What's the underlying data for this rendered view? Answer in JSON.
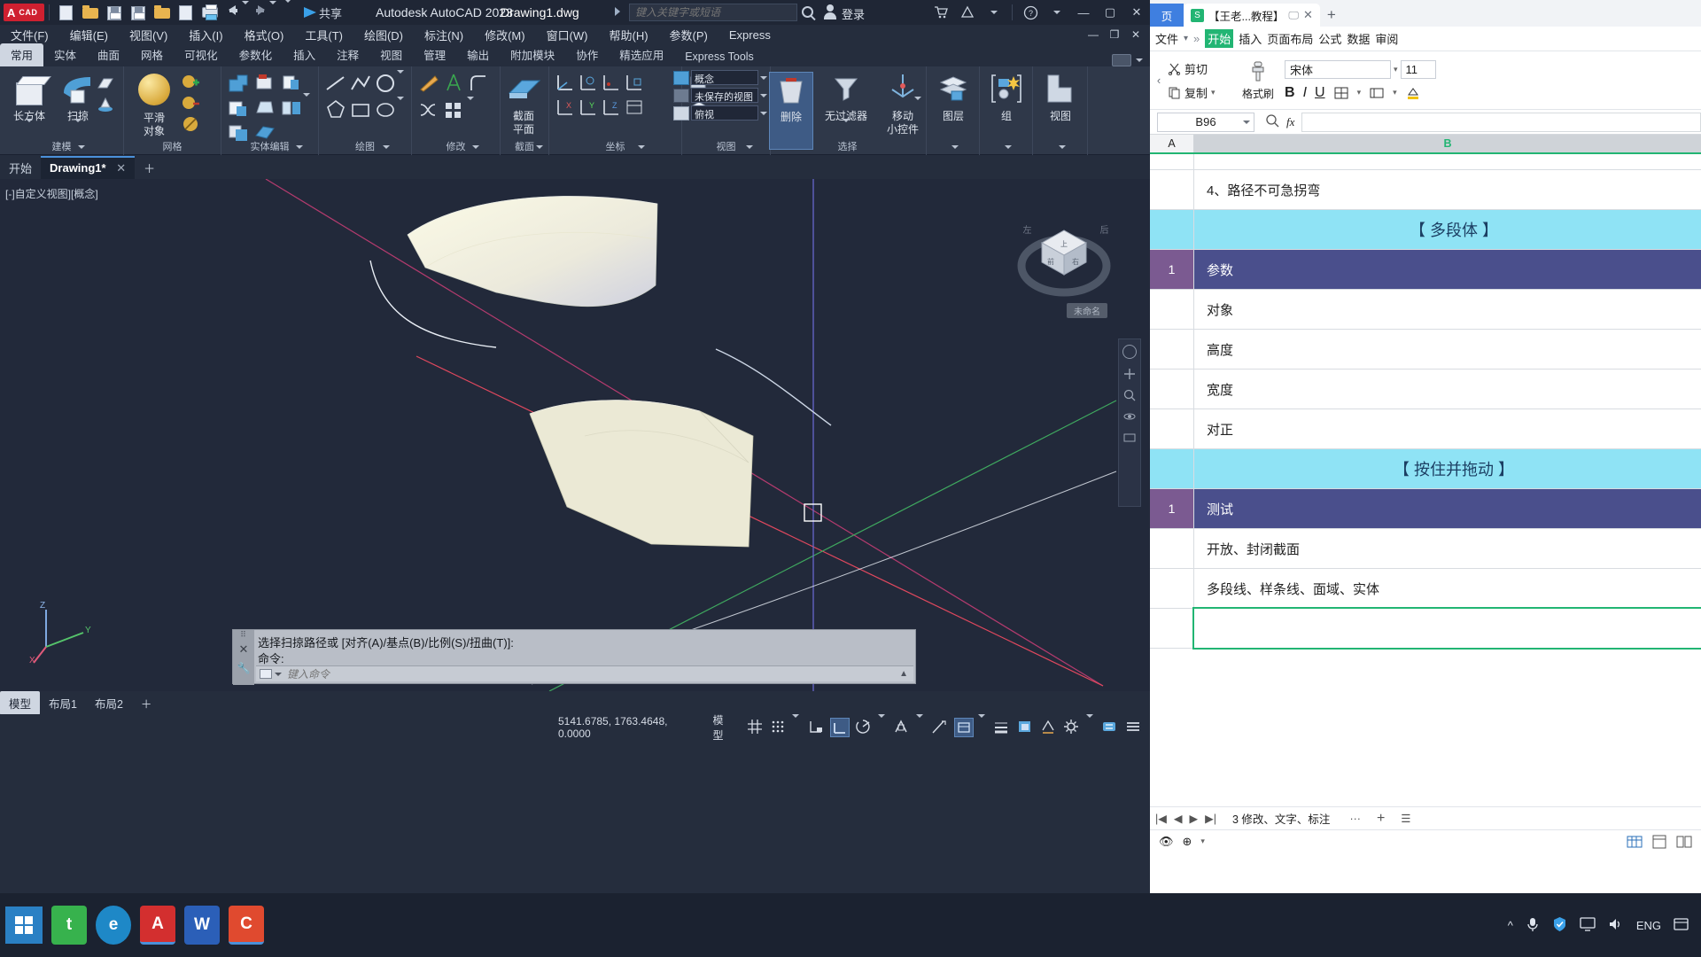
{
  "acad": {
    "quick_access": {
      "logo_a": "A",
      "logo_cad": "CAD",
      "icons": [
        "new-file-icon",
        "open-folder-icon",
        "save-icon",
        "save-as-icon",
        "open-from-web-icon",
        "publish-icon",
        "plot-icon",
        "undo-icon",
        "redo-icon",
        "more-icon"
      ],
      "share_label": "共享"
    },
    "title": "Autodesk AutoCAD 2023",
    "file_name": "Drawing1.dwg",
    "search_placeholder": "键入关键字或短语",
    "login_label": "登录",
    "window_buttons": [
      "minimize",
      "maximize",
      "close"
    ],
    "menubar": [
      "文件(F)",
      "编辑(E)",
      "视图(V)",
      "插入(I)",
      "格式(O)",
      "工具(T)",
      "绘图(D)",
      "标注(N)",
      "修改(M)",
      "窗口(W)",
      "帮助(H)",
      "参数(P)",
      "Express"
    ],
    "ribbon_tabs": [
      {
        "label": "常用",
        "active": true
      },
      {
        "label": "实体",
        "active": false
      },
      {
        "label": "曲面",
        "active": false
      },
      {
        "label": "网格",
        "active": false
      },
      {
        "label": "可视化",
        "active": false
      },
      {
        "label": "参数化",
        "active": false
      },
      {
        "label": "插入",
        "active": false
      },
      {
        "label": "注释",
        "active": false
      },
      {
        "label": "视图",
        "active": false
      },
      {
        "label": "管理",
        "active": false
      },
      {
        "label": "输出",
        "active": false
      },
      {
        "label": "附加模块",
        "active": false
      },
      {
        "label": "协作",
        "active": false
      },
      {
        "label": "精选应用",
        "active": false
      },
      {
        "label": "Express Tools",
        "active": false
      }
    ],
    "panels": [
      {
        "name": "建模",
        "has_dropdown": true,
        "big": [
          {
            "label": "长方体",
            "icon": "box-icon"
          },
          {
            "label": "扫掠",
            "icon": "sweep-icon"
          }
        ]
      },
      {
        "name": "网格",
        "has_dropdown": false,
        "big": [
          {
            "label": "平滑\n对象",
            "icon": "smooth-object-icon"
          }
        ]
      },
      {
        "name": "实体编辑",
        "has_dropdown": true,
        "big": []
      },
      {
        "name": "绘图",
        "has_dropdown": true,
        "big": []
      },
      {
        "name": "修改",
        "has_dropdown": true,
        "big": []
      },
      {
        "name": "截面",
        "has_dropdown": true,
        "big": [
          {
            "label": "截面\n平面",
            "icon": "section-plane-icon"
          }
        ]
      },
      {
        "name": "坐标",
        "has_dropdown": true,
        "big": []
      },
      {
        "name": "视图",
        "has_dropdown": true,
        "big": []
      },
      {
        "name": "选择",
        "has_dropdown": false,
        "big": [
          {
            "label": "删除",
            "icon": "delete-icon"
          },
          {
            "label": "无过滤器",
            "icon": "filter-icon"
          },
          {
            "label": "移动\n小控件",
            "icon": "move-gizmo-icon"
          }
        ]
      },
      {
        "name": "图层",
        "has_dropdown": true,
        "big": [
          {
            "label": "图层",
            "icon": "layers-icon"
          }
        ]
      },
      {
        "name": "组",
        "has_dropdown": true,
        "big": [
          {
            "label": "组",
            "icon": "group-icon"
          }
        ]
      },
      {
        "name": "视图",
        "has_dropdown": true,
        "big": [
          {
            "label": "视图",
            "icon": "view-icon"
          }
        ]
      }
    ],
    "coord_combo": "俯视",
    "vstyle_combo": "概念",
    "unsaved_view_combo": "未保存的视图",
    "doc_tabs": [
      {
        "label": "开始",
        "active": false,
        "closable": false
      },
      {
        "label": "Drawing1*",
        "active": true,
        "closable": true
      }
    ],
    "viewport_label": "[-]自定义视图][概念]",
    "viewcube_labels": {
      "top": "上",
      "front": "前",
      "right": "右",
      "left": "左",
      "back": "后"
    },
    "viewcube_ucs": "未命名",
    "command_lines": [
      "选择扫掠路径或 [对齐(A)/基点(B)/比例(S)/扭曲(T)]:",
      "命令:"
    ],
    "command_placeholder": "键入命令",
    "layout_tabs": [
      {
        "label": "模型",
        "active": true
      },
      {
        "label": "布局1",
        "active": false
      },
      {
        "label": "布局2",
        "active": false
      }
    ],
    "status": {
      "coordinates": "5141.6785, 1763.4648, 0.0000",
      "model_label": "模型",
      "icons": [
        "grid-icon",
        "snap-icon",
        "infer-constraints-icon",
        "ortho-icon",
        "polar-icon",
        "osnap-icon",
        "otrack-icon",
        "lineweight-icon",
        "transparency-icon",
        "selection-cycling-icon",
        "annotation-icon",
        "workspace-gear-icon",
        "hardware-accel-icon",
        "customize-icon"
      ]
    }
  },
  "wps": {
    "tabs": [
      {
        "label": "页",
        "type": "home"
      },
      {
        "label": "【王老...教程】",
        "type": "doc",
        "badge": "S"
      }
    ],
    "new_tab": "+",
    "menu": {
      "file": "文件",
      "overflow": "»",
      "items": [
        "开始",
        "插入",
        "页面布局",
        "公式",
        "数据",
        "审阅"
      ]
    },
    "ribbon": {
      "cut": "剪切",
      "copy": "复制",
      "format_painter": "格式刷",
      "font": "宋体",
      "font_size": "11",
      "bold": "B",
      "italic": "I",
      "underline": "U"
    },
    "name_box": "B96",
    "fx": "fx",
    "columns": [
      "A",
      "B"
    ],
    "rows": [
      {
        "a": "",
        "b": "",
        "type": "blank"
      },
      {
        "a": "",
        "b": "4、路径不可急拐弯",
        "type": "normal"
      },
      {
        "a": "",
        "b": "【 多段体 】",
        "type": "cyan"
      },
      {
        "a": "1",
        "b": "参数",
        "type": "purple"
      },
      {
        "a": "",
        "b": "对象",
        "type": "normal"
      },
      {
        "a": "",
        "b": "高度",
        "type": "normal"
      },
      {
        "a": "",
        "b": "宽度",
        "type": "normal"
      },
      {
        "a": "",
        "b": "对正",
        "type": "normal"
      },
      {
        "a": "",
        "b": "【 按住并拖动 】",
        "type": "cyan"
      },
      {
        "a": "1",
        "b": "测试",
        "type": "purple"
      },
      {
        "a": "",
        "b": "开放、封闭截面",
        "type": "normal"
      },
      {
        "a": "",
        "b": "多段线、样条线、面域、实体",
        "type": "normal"
      },
      {
        "a": "",
        "b": "",
        "type": "selected"
      }
    ],
    "sheet_status": "3 修改、文字、标注",
    "sheet_more": "···",
    "sheet_add": "+",
    "nav": [
      "first-sheet",
      "prev-sheet",
      "next-sheet",
      "last-sheet"
    ],
    "view_icons": [
      "eye-icon",
      "zoom-fit-icon",
      "normal-view-icon",
      "page-layout-icon",
      "reading-view-icon"
    ]
  },
  "taskbar": {
    "start_icon": "windows-start-icon",
    "apps": [
      {
        "name": "taskview-icon",
        "label": "t"
      },
      {
        "name": "edge-icon",
        "label": "e"
      },
      {
        "name": "autocad-icon",
        "label": "A"
      },
      {
        "name": "wps-writer-icon",
        "label": "W"
      },
      {
        "name": "wps-sheet-icon",
        "label": "C"
      }
    ],
    "tray": {
      "chevron": "^",
      "mic": "mic-icon",
      "shield": "shield-icon",
      "monitor": "monitor-icon",
      "volume": "volume-icon",
      "lang": "ENG",
      "notifications": "notification-icon"
    }
  }
}
